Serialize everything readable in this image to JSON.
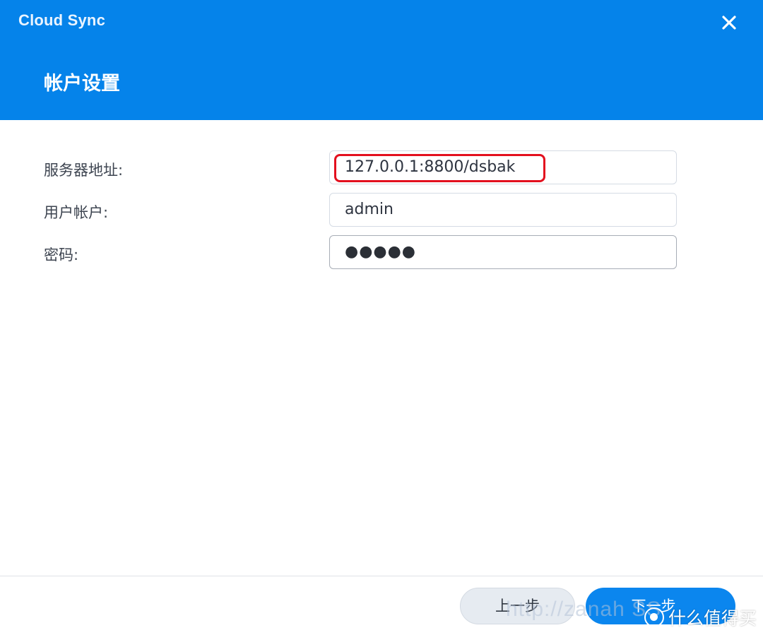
{
  "window": {
    "app_title": "Cloud Sync",
    "dialog_title": "帐户设置"
  },
  "form": {
    "server": {
      "label": "服务器地址:",
      "value": "127.0.0.1:8800/dsbak"
    },
    "user": {
      "label": "用户帐户:",
      "value": "admin"
    },
    "password": {
      "label": "密码:",
      "masked_value": "●●●●●"
    }
  },
  "footer": {
    "prev_label": "上一步",
    "next_label": "下一步"
  },
  "overlay": {
    "watermark": "http://zanah  SS",
    "brand": "什么值得买"
  },
  "colors": {
    "header_bg": "#0583ea",
    "primary_button": "#0b86ee",
    "highlight": "#e3101e"
  },
  "icons": {
    "close": "close-icon",
    "brand": "brand-logo-icon"
  }
}
